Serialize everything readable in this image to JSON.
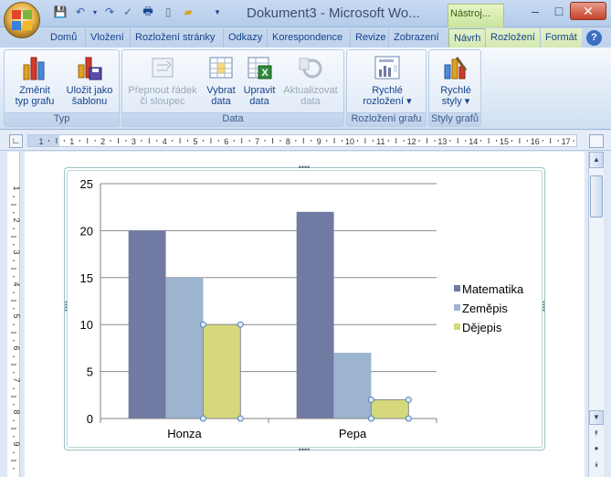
{
  "window": {
    "title": "Dokument3 - Microsoft Wo...",
    "context_tab": "Nástroj..."
  },
  "tabs": [
    {
      "label": "Domů"
    },
    {
      "label": "Vložení"
    },
    {
      "label": "Rozložení stránky"
    },
    {
      "label": "Odkazy"
    },
    {
      "label": "Korespondence"
    },
    {
      "label": "Revize"
    },
    {
      "label": "Zobrazení"
    },
    {
      "label": "Návrh",
      "active": true
    },
    {
      "label": "Rozložení"
    },
    {
      "label": "Formát"
    }
  ],
  "ribbon": {
    "groups": [
      {
        "label": "Typ",
        "buttons": [
          {
            "label1": "Změnit",
            "label2": "typ grafu",
            "icon": "chart-type-icon"
          },
          {
            "label1": "Uložit jako",
            "label2": "šablonu",
            "icon": "save-template-icon"
          }
        ]
      },
      {
        "label": "Data",
        "buttons": [
          {
            "label1": "Přepnout řádek",
            "label2": "či sloupec",
            "icon": "switch-row-column-icon",
            "disabled": true
          },
          {
            "label1": "Vybrat",
            "label2": "data",
            "icon": "select-data-icon"
          },
          {
            "label1": "Upravit",
            "label2": "data",
            "icon": "edit-data-icon"
          },
          {
            "label1": "Aktualizovat",
            "label2": "data",
            "icon": "refresh-data-icon",
            "disabled": true
          }
        ]
      },
      {
        "label": "Rozložení grafu",
        "buttons": [
          {
            "label1": "Rychlé",
            "label2": "rozložení ▾",
            "icon": "quick-layout-icon"
          }
        ]
      },
      {
        "label": "Styly grafů",
        "buttons": [
          {
            "label1": "Rychlé",
            "label2": "styly ▾",
            "icon": "quick-styles-icon"
          }
        ]
      }
    ]
  },
  "ruler": {
    "labels": [
      "1",
      "1",
      "2",
      "3",
      "4",
      "5",
      "6",
      "7",
      "8",
      "9",
      "10",
      "11",
      "12",
      "13",
      "14",
      "15",
      "16",
      "17"
    ],
    "vertical_labels": [
      "1",
      "2",
      "3",
      "4",
      "5",
      "6",
      "7",
      "8",
      "9"
    ]
  },
  "chart_data": {
    "type": "bar",
    "categories": [
      "Honza",
      "Pepa"
    ],
    "series": [
      {
        "name": "Matematika",
        "values": [
          20,
          22
        ],
        "color": "#717aa3"
      },
      {
        "name": "Zeměpis",
        "values": [
          15,
          7
        ],
        "color": "#9db4cf"
      },
      {
        "name": "Dějepis",
        "values": [
          10,
          2
        ],
        "color": "#d5d87b"
      }
    ],
    "ylim": [
      0,
      25
    ],
    "yticks": [
      "0",
      "5",
      "10",
      "15",
      "20",
      "25"
    ],
    "grid": true,
    "legend": "right",
    "title": "",
    "xlabel": "",
    "ylabel": ""
  },
  "colors": {
    "ribbon_text": "#15428b",
    "tab_active_border": "#9fc07f",
    "chart_selection": "#4f81bd"
  }
}
